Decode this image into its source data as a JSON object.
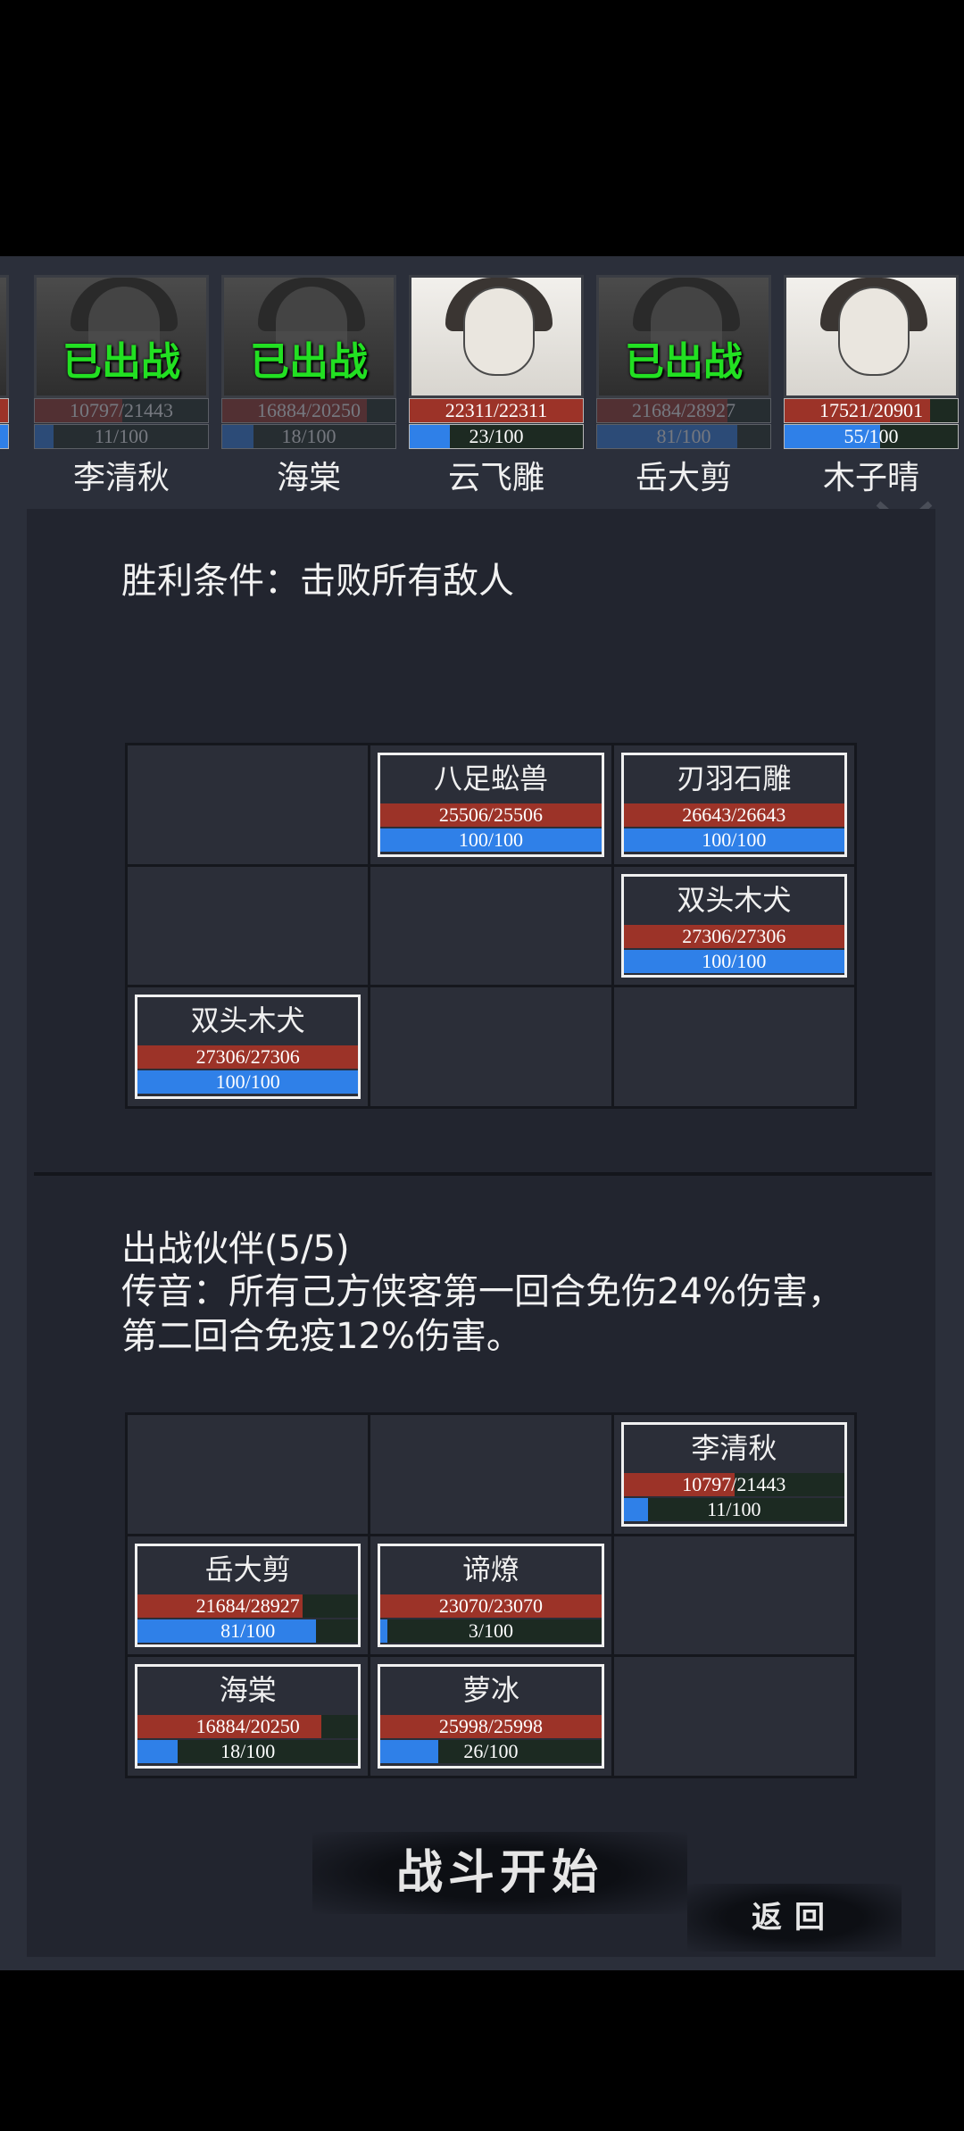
{
  "roster": [
    {
      "name": "李清秋",
      "hp": "10797/21443",
      "hp_ratio": 0.503,
      "mp": "11/100",
      "mp_ratio": 0.11,
      "deployed": true,
      "deployed_label": "已出战",
      "portrait": "dark"
    },
    {
      "name": "海棠",
      "hp": "16884/20250",
      "hp_ratio": 0.834,
      "mp": "18/100",
      "mp_ratio": 0.18,
      "deployed": true,
      "deployed_label": "已出战",
      "portrait": "dark"
    },
    {
      "name": "云飞雕",
      "hp": "22311/22311",
      "hp_ratio": 1.0,
      "mp": "23/100",
      "mp_ratio": 0.23,
      "deployed": false,
      "deployed_label": "",
      "portrait": "light"
    },
    {
      "name": "岳大剪",
      "hp": "21684/28927",
      "hp_ratio": 0.75,
      "mp": "81/100",
      "mp_ratio": 0.81,
      "deployed": true,
      "deployed_label": "已出战",
      "portrait": "dark"
    },
    {
      "name": "木子晴",
      "hp": "17521/20901",
      "hp_ratio": 0.838,
      "mp": "55/100",
      "mp_ratio": 0.55,
      "deployed": false,
      "deployed_label": "",
      "portrait": "light"
    }
  ],
  "victory_condition": "胜利条件：击败所有敌人",
  "enemy_grid": [
    null,
    {
      "name": "八足蚣兽",
      "hp": "25506/25506",
      "hp_ratio": 1.0,
      "mp": "100/100",
      "mp_ratio": 1.0
    },
    {
      "name": "刃羽石雕",
      "hp": "26643/26643",
      "hp_ratio": 1.0,
      "mp": "100/100",
      "mp_ratio": 1.0
    },
    null,
    null,
    {
      "name": "双头木犬",
      "hp": "27306/27306",
      "hp_ratio": 1.0,
      "mp": "100/100",
      "mp_ratio": 1.0
    },
    {
      "name": "双头木犬",
      "hp": "27306/27306",
      "hp_ratio": 1.0,
      "mp": "100/100",
      "mp_ratio": 1.0
    },
    null,
    null
  ],
  "party": {
    "title": "出战伙伴(5/5)",
    "description": "传音：所有己方侠客第一回合免伤24%伤害，第二回合免疫12%伤害。"
  },
  "party_grid": [
    null,
    null,
    {
      "name": "李清秋",
      "hp": "10797/21443",
      "hp_ratio": 0.503,
      "mp": "11/100",
      "mp_ratio": 0.11
    },
    {
      "name": "岳大剪",
      "hp": "21684/28927",
      "hp_ratio": 0.75,
      "mp": "81/100",
      "mp_ratio": 0.81
    },
    {
      "name": "谛燎",
      "hp": "23070/23070",
      "hp_ratio": 1.0,
      "mp": "3/100",
      "mp_ratio": 0.03
    },
    null,
    {
      "name": "海棠",
      "hp": "16884/20250",
      "hp_ratio": 0.834,
      "mp": "18/100",
      "mp_ratio": 0.18
    },
    {
      "name": "萝冰",
      "hp": "25998/25998",
      "hp_ratio": 1.0,
      "mp": "26/100",
      "mp_ratio": 0.26
    },
    null
  ],
  "buttons": {
    "start": "战斗开始",
    "back": "返回"
  },
  "colors": {
    "hp": "#9c3328",
    "mp": "#2f80e8",
    "deployed_tag": "#22e022",
    "background": "#2b2f3a"
  }
}
